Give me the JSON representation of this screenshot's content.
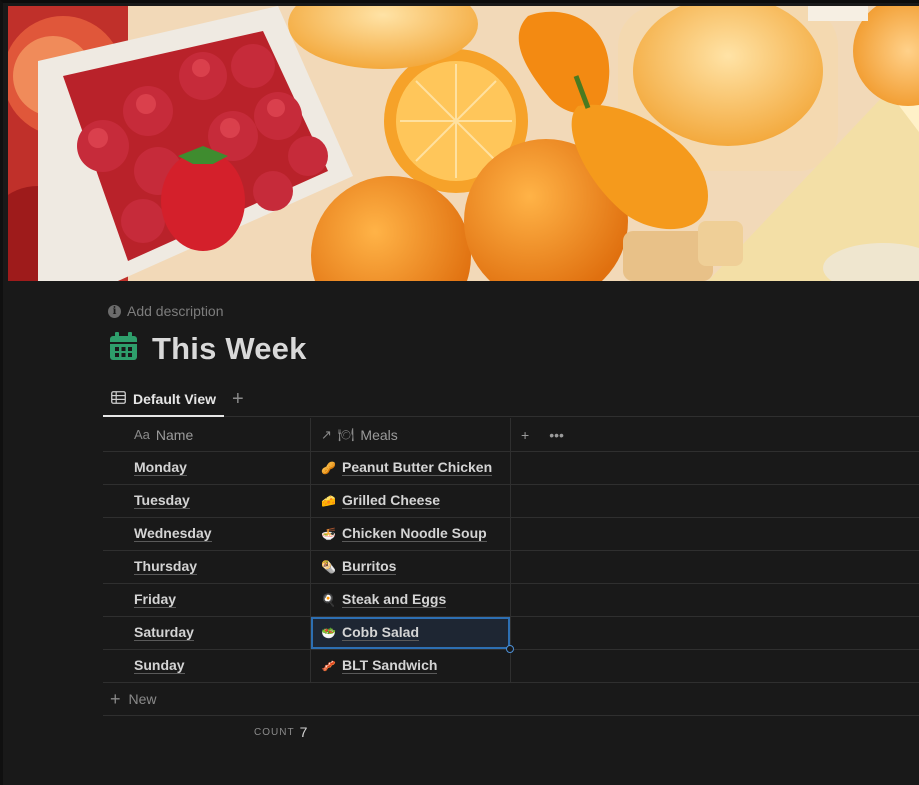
{
  "database": {
    "description_placeholder": "Add description",
    "title": "This Week",
    "icon": "calendar-icon",
    "accent_color": "#2e9e6b"
  },
  "views": {
    "tabs": [
      {
        "label": "Default View",
        "icon": "table-icon",
        "active": true
      }
    ],
    "add_icon": "plus-icon"
  },
  "table": {
    "columns": [
      {
        "label": "Name",
        "icon": "Aa"
      },
      {
        "label": "Meals",
        "icon": "relation-icon"
      }
    ],
    "rows": [
      {
        "name": "Monday",
        "meal": "Peanut Butter Chicken",
        "emoji": "🥜"
      },
      {
        "name": "Tuesday",
        "meal": "Grilled Cheese",
        "emoji": "🧀"
      },
      {
        "name": "Wednesday",
        "meal": "Chicken Noodle Soup",
        "emoji": "🍜"
      },
      {
        "name": "Thursday",
        "meal": "Burritos",
        "emoji": "🌯"
      },
      {
        "name": "Friday",
        "meal": "Steak and Eggs",
        "emoji": "🍳"
      },
      {
        "name": "Saturday",
        "meal": "Cobb Salad",
        "emoji": "🥗",
        "selected": true
      },
      {
        "name": "Sunday",
        "meal": "BLT Sandwich",
        "emoji": "🥓"
      }
    ],
    "new_label": "New",
    "count_label": "COUNT",
    "count_value": "7",
    "selection_color": "#2d6fb3"
  }
}
